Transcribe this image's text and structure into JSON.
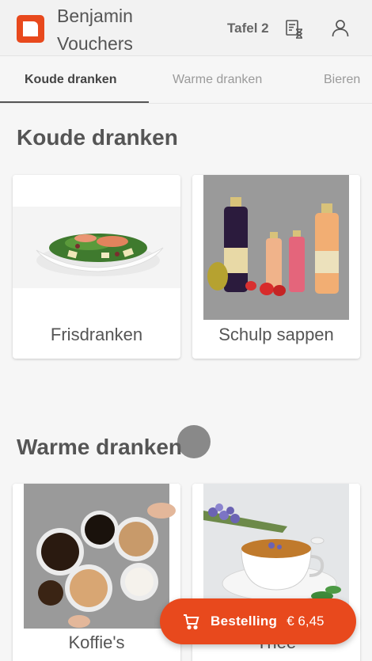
{
  "header": {
    "brand": "Benjamin Vouchers",
    "table": "Tafel 2",
    "colors": {
      "accent": "#e8491d",
      "background": "#f2f2f2"
    },
    "icons": [
      "receipt-timer-icon",
      "user-icon"
    ]
  },
  "tabs": [
    {
      "label": "Koude dranken",
      "active": true
    },
    {
      "label": "Warme dranken",
      "active": false
    },
    {
      "label": "Bieren",
      "active": false
    }
  ],
  "sections": [
    {
      "title": "Koude dranken",
      "items": [
        {
          "label": "Frisdranken"
        },
        {
          "label": "Schulp sappen"
        }
      ]
    },
    {
      "title": "Warme dranken",
      "items": [
        {
          "label": "Koffie's"
        },
        {
          "label": "Thee"
        }
      ]
    }
  ],
  "order": {
    "label": "Bestelling",
    "price": "€ 6,45",
    "icon": "cart-icon"
  }
}
